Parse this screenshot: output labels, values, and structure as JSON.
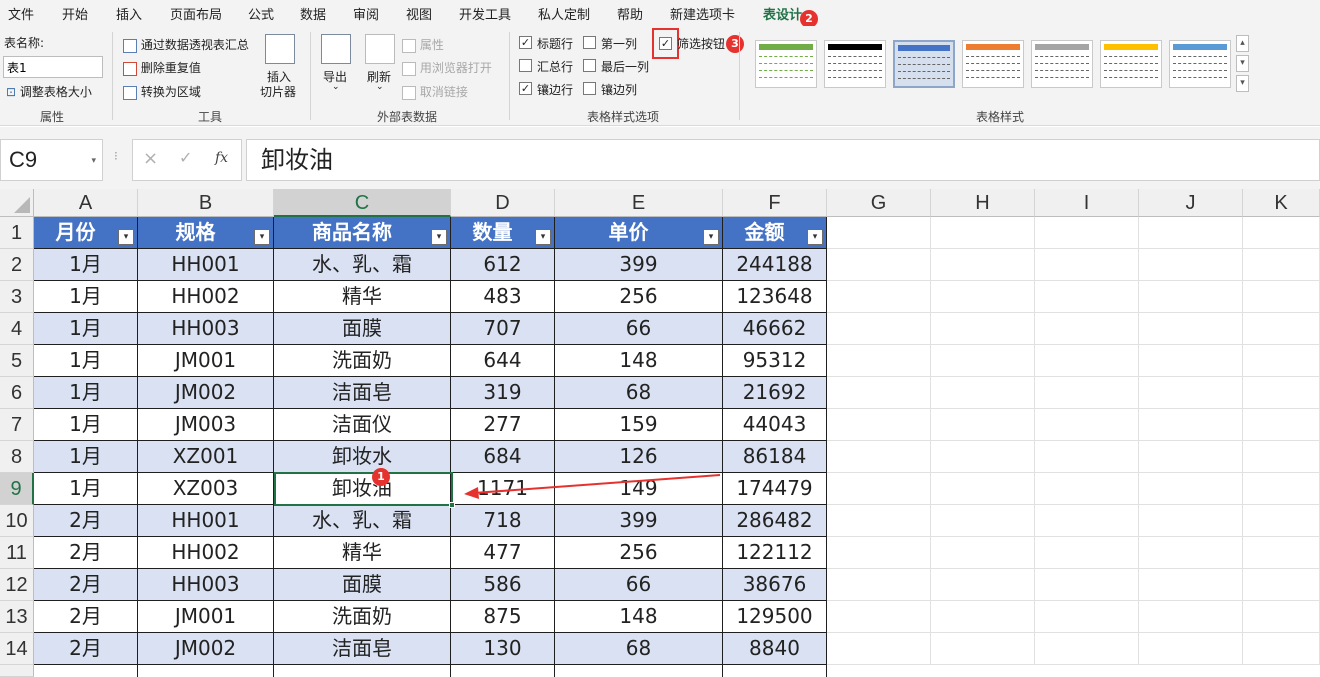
{
  "menu": {
    "items": [
      "文件",
      "开始",
      "插入",
      "页面布局",
      "公式",
      "数据",
      "审阅",
      "视图",
      "开发工具",
      "私人定制",
      "帮助",
      "新建选项卡",
      "表设计"
    ],
    "active": "表设计"
  },
  "ribbon": {
    "properties": {
      "table_name_label": "表名称:",
      "table_name_value": "表1",
      "resize_label": "调整表格大小",
      "group_label": "属性"
    },
    "tools": {
      "pivot_label": "通过数据透视表汇总",
      "remove_dup_label": "删除重复值",
      "convert_label": "转换为区域",
      "slicer_label_1": "插入",
      "slicer_label_2": "切片器",
      "group_label": "工具"
    },
    "external": {
      "export_label": "导出",
      "refresh_label": "刷新",
      "properties_label": "属性",
      "open_browser_label": "用浏览器打开",
      "unlink_label": "取消链接",
      "group_label": "外部表数据"
    },
    "style_options": {
      "header_row": {
        "label": "标题行",
        "checked": true
      },
      "total_row": {
        "label": "汇总行",
        "checked": false
      },
      "banded_rows": {
        "label": "镶边行",
        "checked": true
      },
      "first_column": {
        "label": "第一列",
        "checked": false
      },
      "last_column": {
        "label": "最后一列",
        "checked": false
      },
      "banded_columns": {
        "label": "镶边列",
        "checked": false
      },
      "filter_button": {
        "label": "筛选按钮",
        "checked": true
      },
      "group_label": "表格样式选项"
    },
    "table_styles": {
      "group_label": "表格样式",
      "swatch_colors": [
        "#70ad47",
        "#000000",
        "#4472c4",
        "#ed7d31",
        "#a5a5a5",
        "#ffc000",
        "#5b9bd5"
      ]
    }
  },
  "badges": {
    "cell": "1",
    "tab": "2",
    "filter": "3"
  },
  "formula_bar": {
    "name_box": "C9",
    "cancel_icon": "×",
    "enter_icon": "✓",
    "fx_label": "fx",
    "value": "卸妆油"
  },
  "grid": {
    "column_letters": [
      "A",
      "B",
      "C",
      "D",
      "E",
      "F",
      "G",
      "H",
      "I",
      "J",
      "K"
    ],
    "row_numbers": [
      "1",
      "2",
      "3",
      "4",
      "5",
      "6",
      "7",
      "8",
      "9",
      "10",
      "11",
      "12",
      "13",
      "14"
    ],
    "headers": [
      "月份",
      "规格",
      "商品名称",
      "数量",
      "单价",
      "金额"
    ],
    "rows": [
      [
        "1月",
        "HH001",
        "水、乳、霜",
        "612",
        "399",
        "244188"
      ],
      [
        "1月",
        "HH002",
        "精华",
        "483",
        "256",
        "123648"
      ],
      [
        "1月",
        "HH003",
        "面膜",
        "707",
        "66",
        "46662"
      ],
      [
        "1月",
        "JM001",
        "洗面奶",
        "644",
        "148",
        "95312"
      ],
      [
        "1月",
        "JM002",
        "洁面皂",
        "319",
        "68",
        "21692"
      ],
      [
        "1月",
        "JM003",
        "洁面仪",
        "277",
        "159",
        "44043"
      ],
      [
        "1月",
        "XZ001",
        "卸妆水",
        "684",
        "126",
        "86184"
      ],
      [
        "1月",
        "XZ003",
        "卸妆油",
        "1171",
        "149",
        "174479"
      ],
      [
        "2月",
        "HH001",
        "水、乳、霜",
        "718",
        "399",
        "286482"
      ],
      [
        "2月",
        "HH002",
        "精华",
        "477",
        "256",
        "122112"
      ],
      [
        "2月",
        "HH003",
        "面膜",
        "586",
        "66",
        "38676"
      ],
      [
        "2月",
        "JM001",
        "洗面奶",
        "875",
        "148",
        "129500"
      ],
      [
        "2月",
        "JM002",
        "洁面皂",
        "130",
        "68",
        "8840"
      ]
    ],
    "header_color": "#4472c4",
    "band_color": "#d9e1f2",
    "accent_color": "#217346",
    "annotation_color": "#e5322e"
  }
}
